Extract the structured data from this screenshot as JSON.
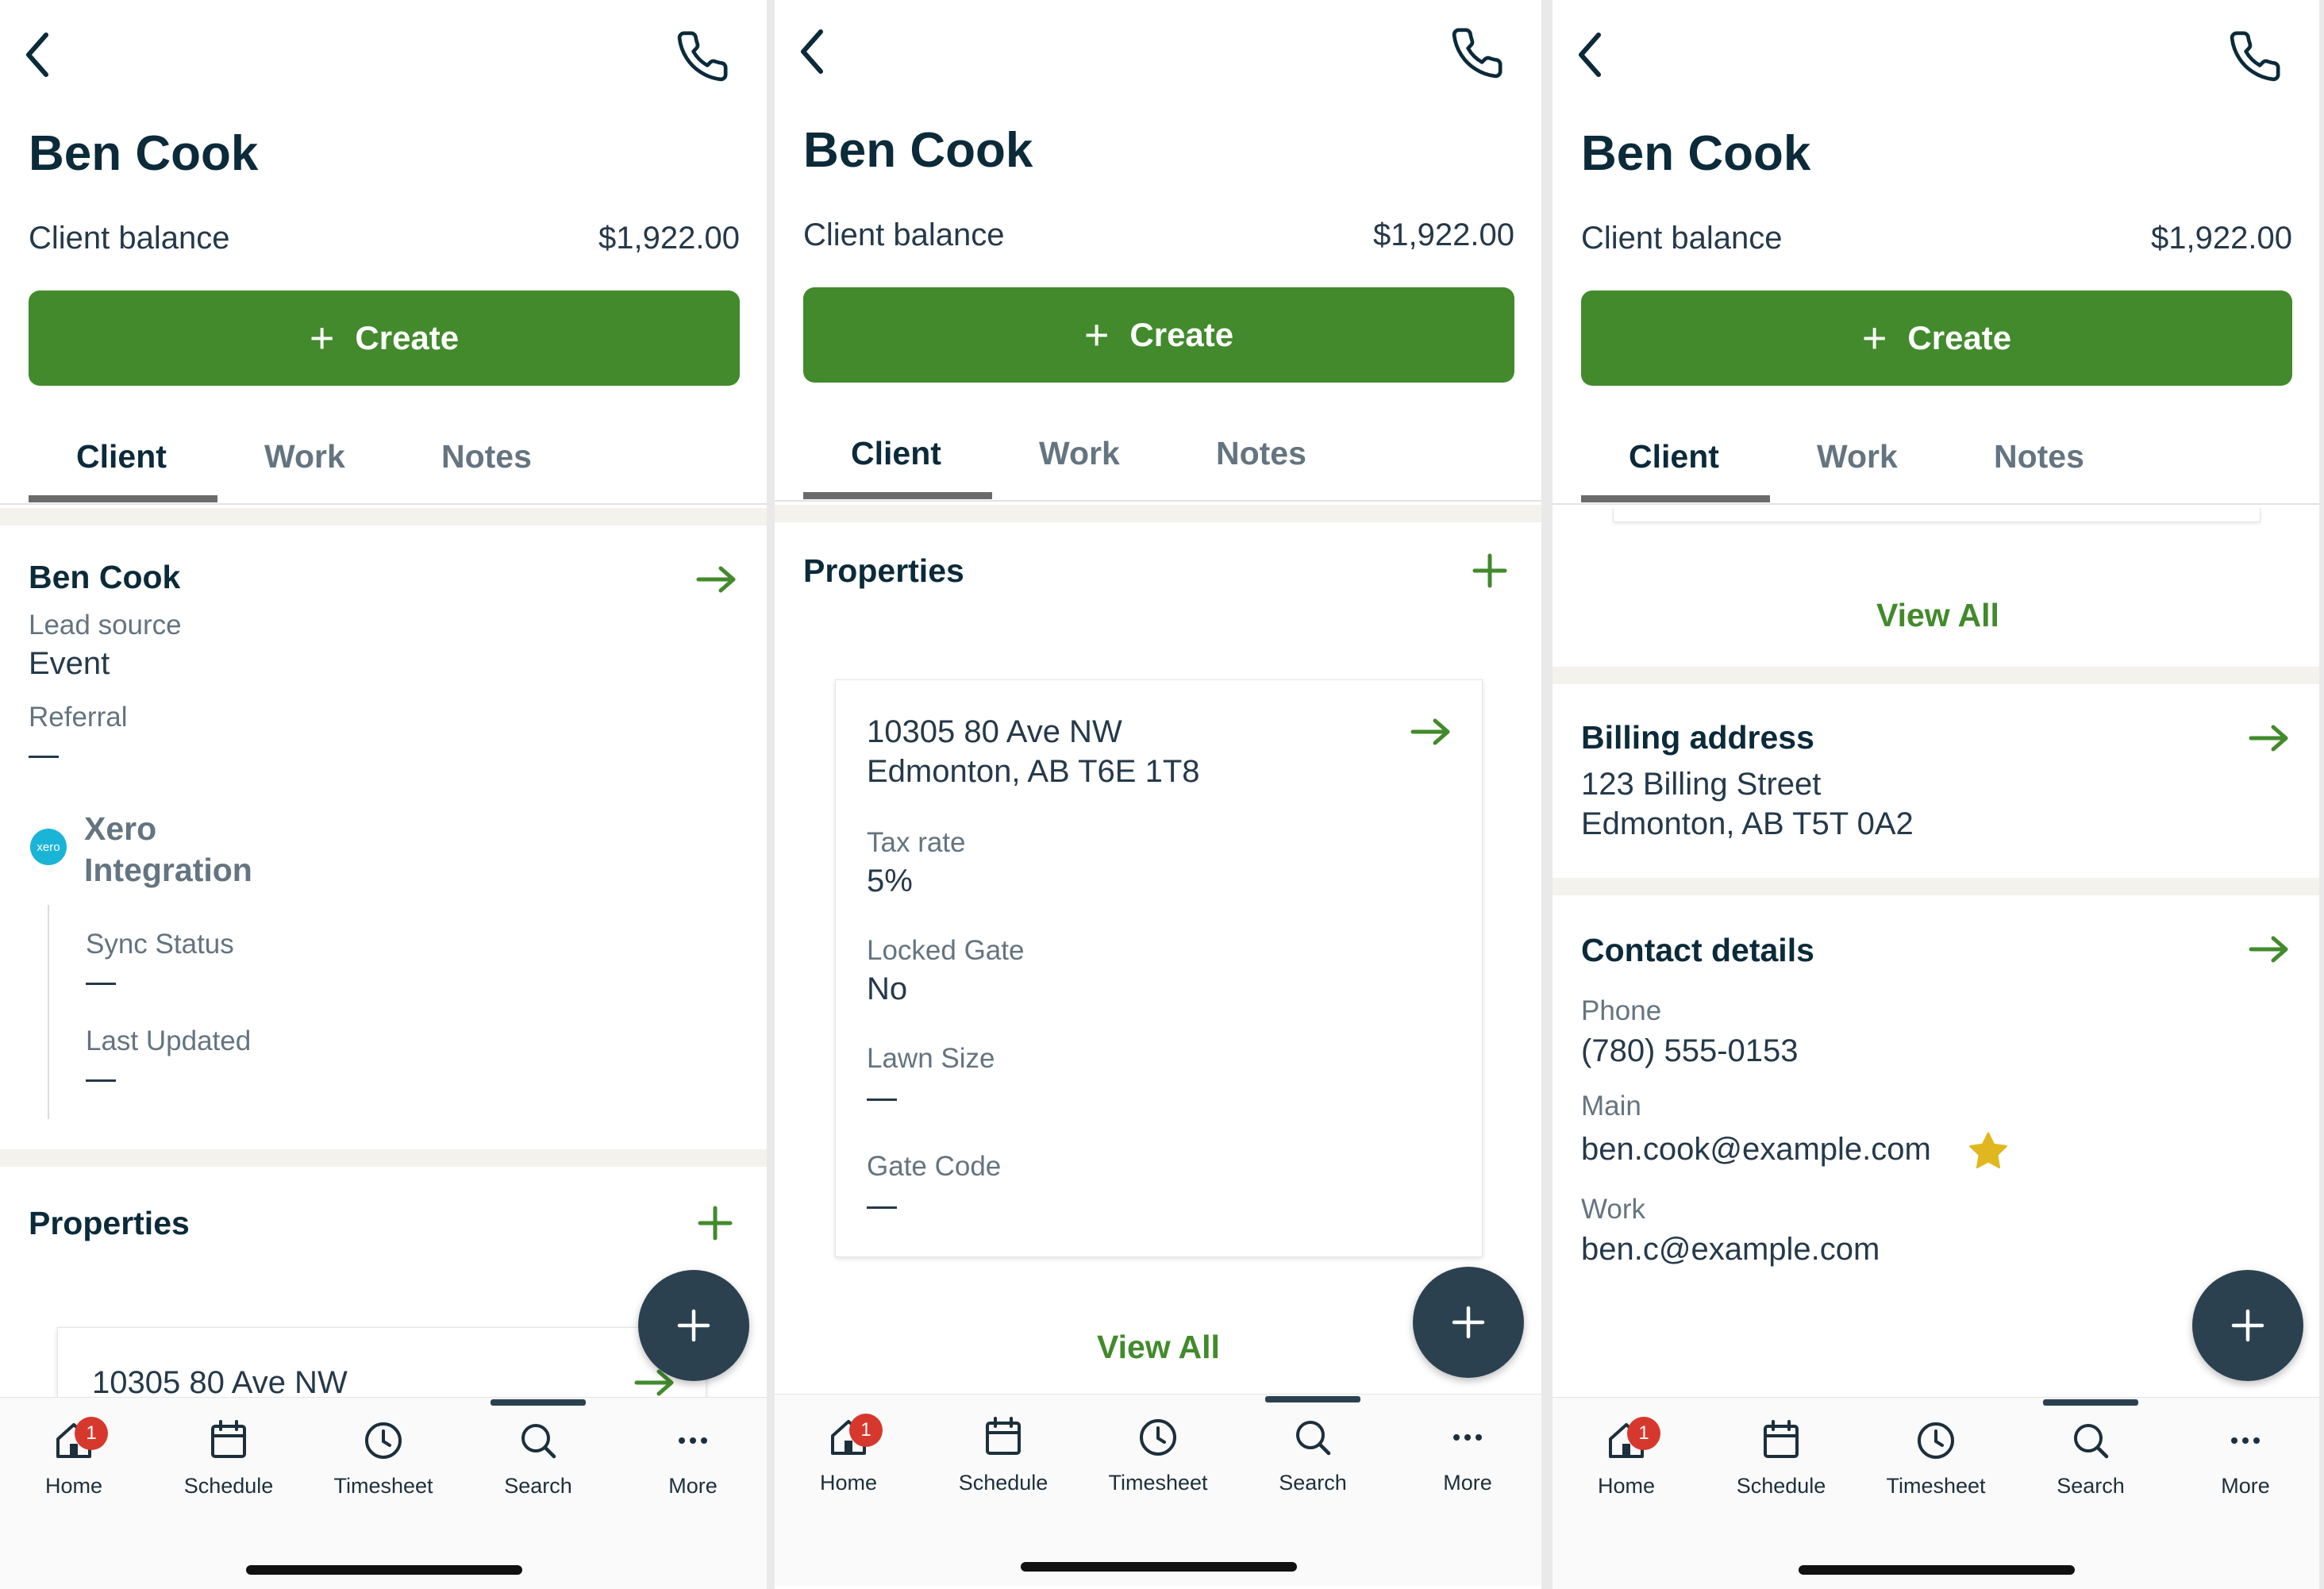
{
  "client_name": "Ben Cook",
  "balance_label": "Client balance",
  "balance_value": "$1,922.00",
  "create_label": "Create",
  "tabs": [
    "Client",
    "Work",
    "Notes"
  ],
  "nav": {
    "home": "Home",
    "schedule": "Schedule",
    "timesheet": "Timesheet",
    "search": "Search",
    "more": "More",
    "home_badge": "1"
  },
  "client_section": {
    "name": "Ben Cook",
    "lead_source_label": "Lead source",
    "lead_source_value": "Event",
    "referral_label": "Referral",
    "xero_logo_text": "xero",
    "xero_title_line1": "Xero",
    "xero_title_line2": "Integration",
    "sync_status_label": "Sync Status",
    "last_updated_label": "Last Updated"
  },
  "properties": {
    "title": "Properties",
    "address_line1": "10305 80 Ave NW",
    "address_line2": "Edmonton, AB T6E 1T8",
    "tax_rate_label": "Tax rate",
    "tax_rate_value": "5%",
    "locked_gate_label": "Locked Gate",
    "locked_gate_value": "No",
    "lawn_size_label": "Lawn Size",
    "gate_code_label": "Gate Code",
    "view_all": "View All"
  },
  "billing": {
    "title": "Billing address",
    "line1": "123 Billing Street",
    "line2": "Edmonton, AB T5T 0A2"
  },
  "contact": {
    "title": "Contact details",
    "phone_label": "Phone",
    "phone_value": "(780) 555-0153",
    "main_label": "Main",
    "main_email": "ben.cook@example.com",
    "work_label": "Work",
    "work_email": "ben.c@example.com"
  },
  "colors": {
    "brand_green": "#428a2c",
    "dark_navy": "#0b2a3a",
    "fab": "#2b4150",
    "badge": "#d7382e",
    "star": "#e0b71f",
    "xero": "#1ab4d7"
  }
}
